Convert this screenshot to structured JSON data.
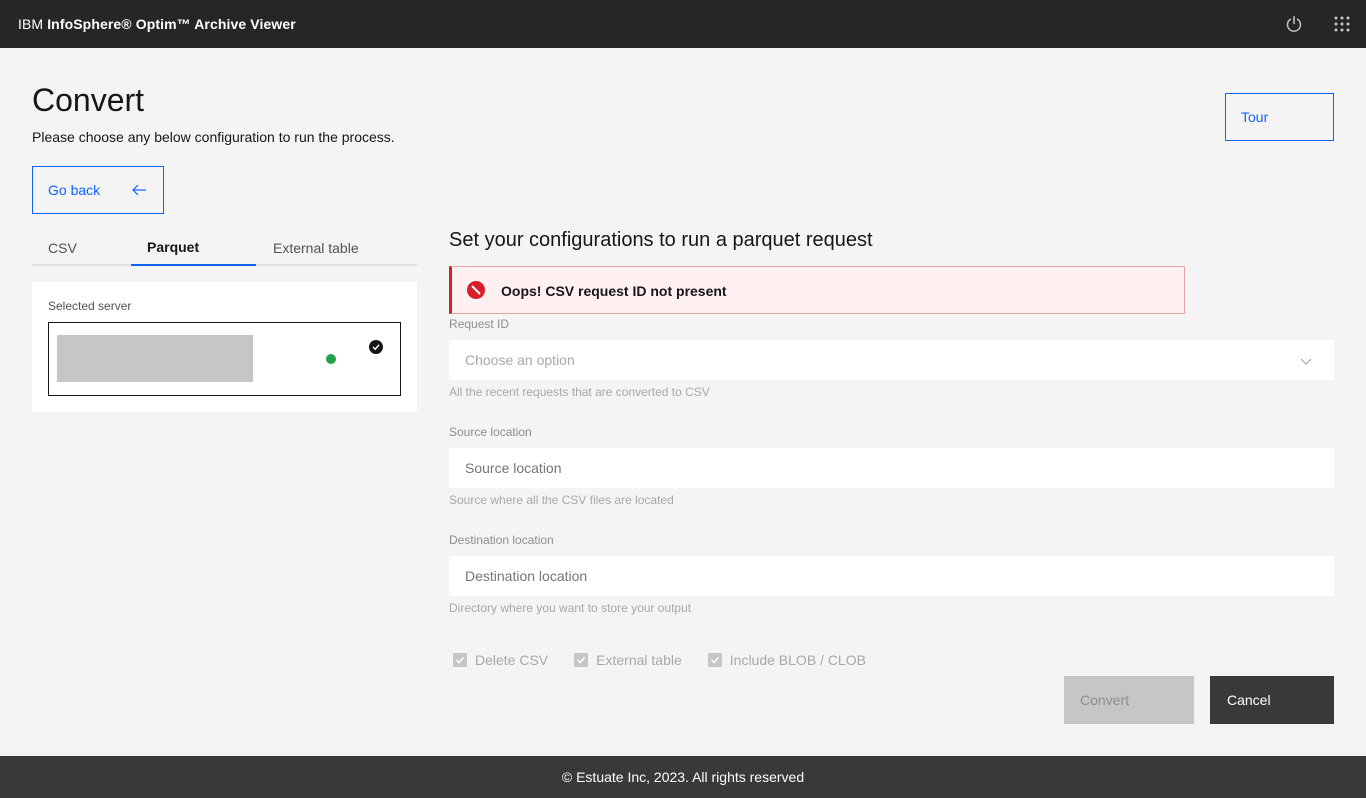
{
  "header": {
    "brand_prefix": "IBM ",
    "brand_product": "InfoSphere® Optim™ Archive Viewer",
    "power_icon": "power-icon",
    "menu_icon": "app-switcher-grid-icon"
  },
  "page": {
    "title": "Convert",
    "subtitle": "Please choose any below configuration to run the process.",
    "tour_label": "Tour",
    "go_back_label": "Go back"
  },
  "tabs": [
    {
      "label": "CSV",
      "selected": false
    },
    {
      "label": "Parquet",
      "selected": true
    },
    {
      "label": "External table",
      "selected": false
    }
  ],
  "server": {
    "label": "Selected server",
    "status_color": "#24a148",
    "selected": true
  },
  "form": {
    "heading": "Set your configurations to run a parquet request",
    "error_message": "Oops! CSV request ID not present",
    "request_id": {
      "label": "Request ID",
      "placeholder": "Choose an option",
      "helper": "All the recent requests that are converted to CSV"
    },
    "source": {
      "label": "Source location",
      "placeholder": "Source location",
      "helper": "Source where all the CSV files are located"
    },
    "destination": {
      "label": "Destination location",
      "placeholder": "Destination location",
      "helper": "Directory where you want to store your output"
    },
    "checkboxes": [
      {
        "label": "Delete CSV",
        "checked": true,
        "disabled": true
      },
      {
        "label": "External table",
        "checked": true,
        "disabled": true
      },
      {
        "label": "Include BLOB / CLOB",
        "checked": true,
        "disabled": true
      }
    ],
    "convert_label": "Convert",
    "cancel_label": "Cancel"
  },
  "footer": {
    "text": "© Estuate Inc, 2023.  All rights reserved"
  },
  "colors": {
    "accent": "#0f62fe",
    "error": "#da1e28",
    "success": "#24a148"
  }
}
